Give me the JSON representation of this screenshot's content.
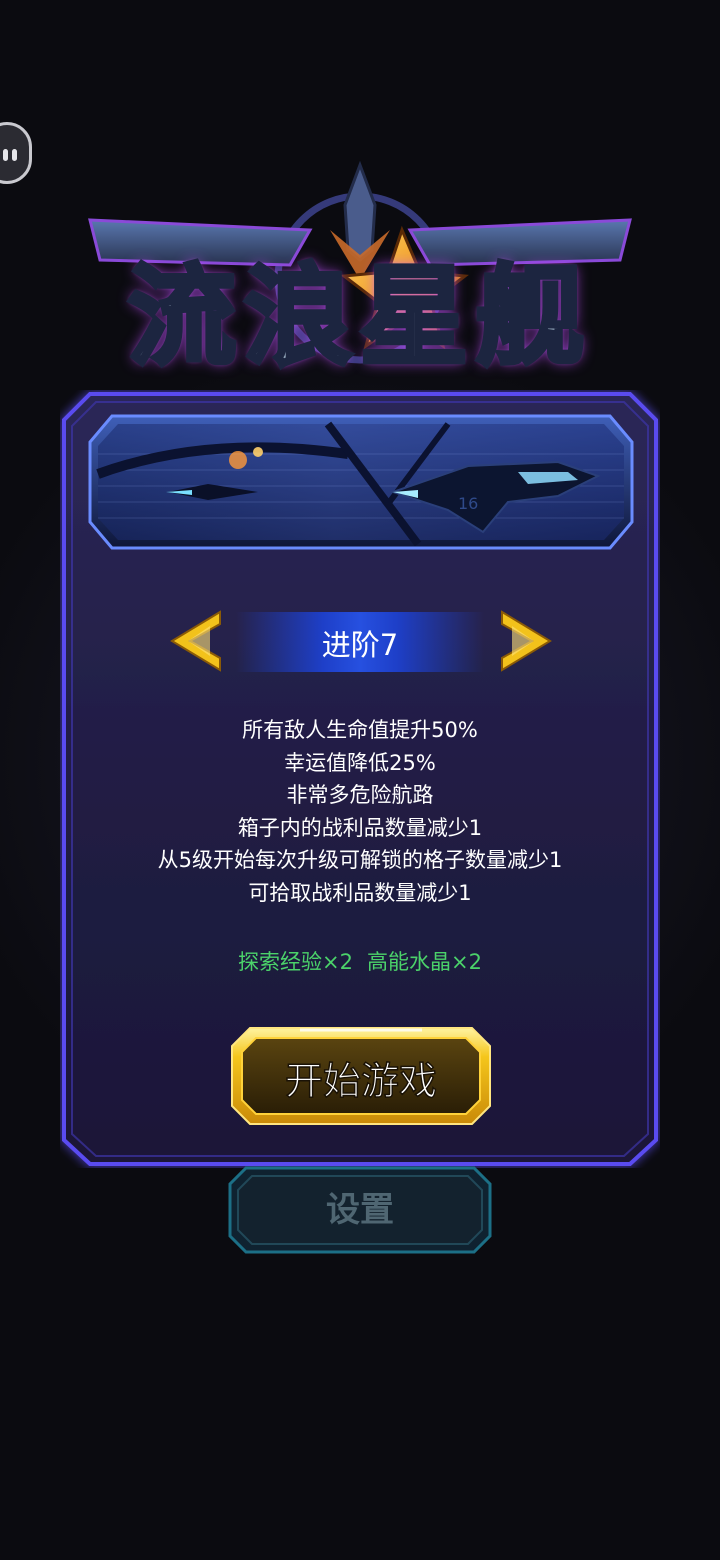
{
  "game": {
    "title": "流浪星舰"
  },
  "difficulty": {
    "level_label": "进阶7",
    "prev_icon": "chevron-double-left-icon",
    "next_icon": "chevron-double-right-icon",
    "modifiers": [
      "所有敌人生命值提升50%",
      "幸运值降低25%",
      "非常多危险航路",
      "箱子内的战利品数量减少1",
      "从5级开始每次升级可解锁的格子数量减少1",
      "可拾取战利品数量减少1"
    ],
    "rewards": [
      "探索经验×2",
      "高能水晶×2"
    ]
  },
  "buttons": {
    "start": "开始游戏",
    "settings": "设置"
  },
  "colors": {
    "panel_border": "#5a4cf0",
    "panel_fill": "#25204a",
    "gold": "#f2c21b",
    "reward_green": "#4bd26a",
    "level_blue": "#2650e0"
  }
}
